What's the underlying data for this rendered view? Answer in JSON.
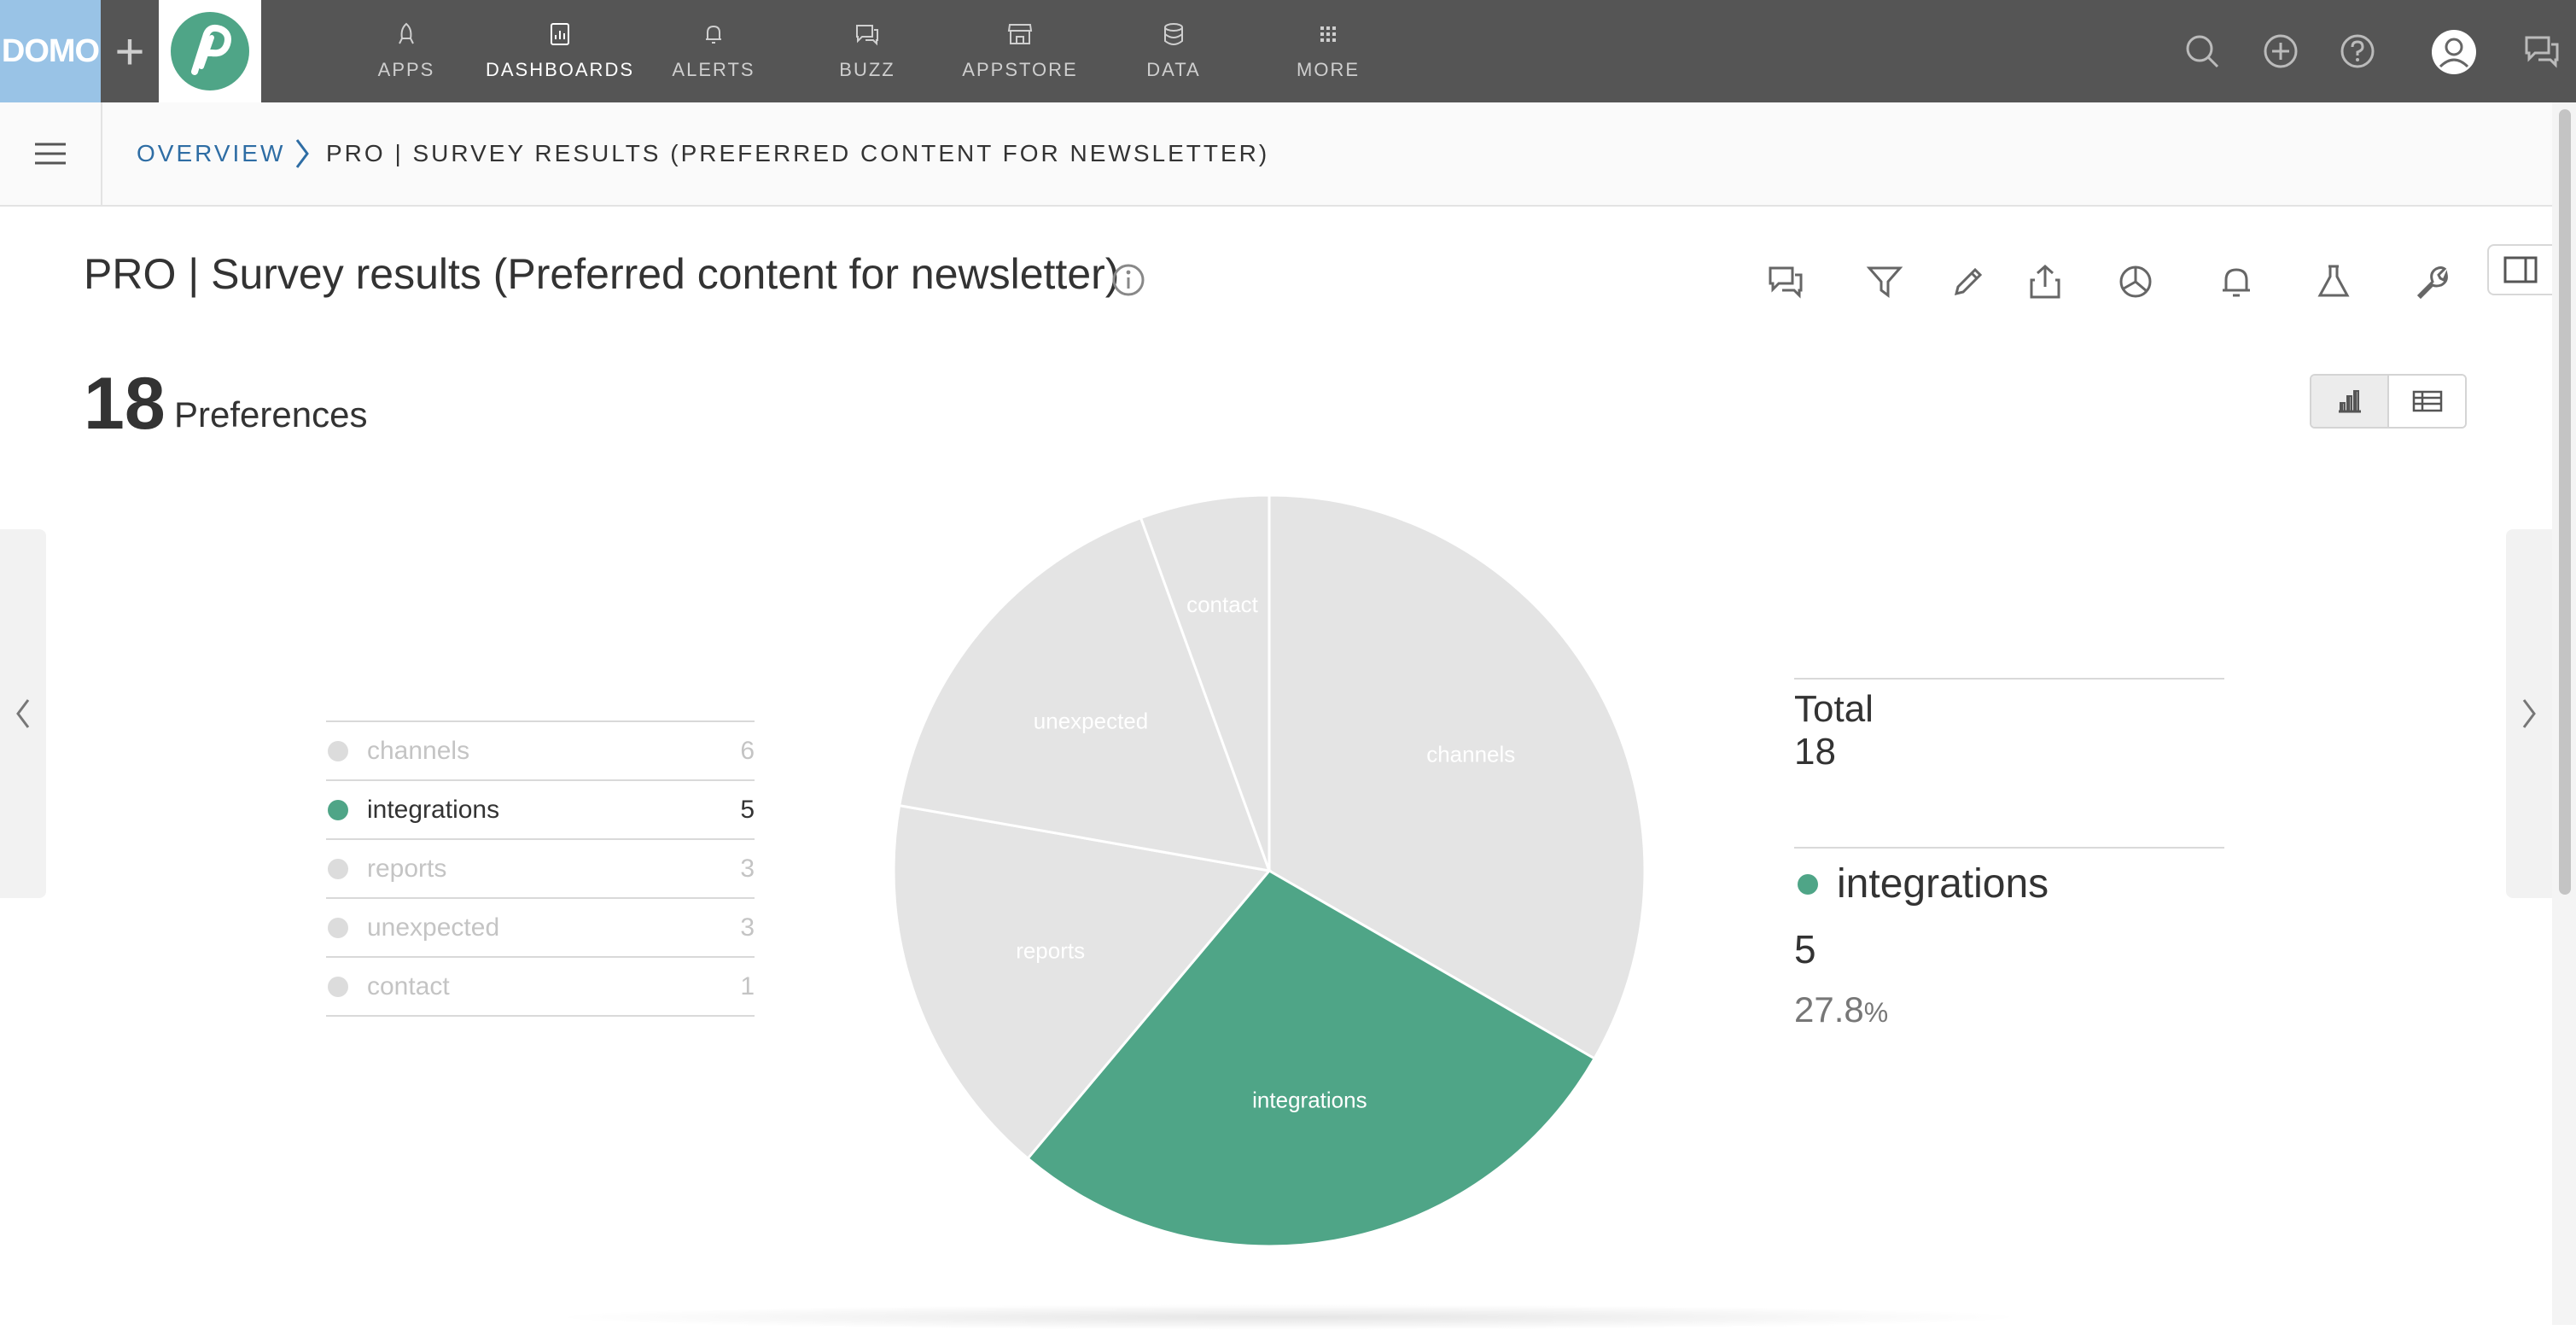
{
  "brand": {
    "domo_label": "DOMO",
    "plus": "+"
  },
  "nav": {
    "items": [
      {
        "label": "APPS",
        "icon": "rocket-icon"
      },
      {
        "label": "DASHBOARDS",
        "icon": "dashboard-icon",
        "active": true
      },
      {
        "label": "ALERTS",
        "icon": "bell-icon"
      },
      {
        "label": "BUZZ",
        "icon": "chat-icon"
      },
      {
        "label": "APPSTORE",
        "icon": "store-icon"
      },
      {
        "label": "DATA",
        "icon": "database-icon"
      },
      {
        "label": "MORE",
        "icon": "grid-icon"
      }
    ]
  },
  "breadcrumb": {
    "parent": "OVERVIEW",
    "current": "PRO | SURVEY RESULTS (PREFERRED CONTENT FOR NEWSLETTER)"
  },
  "card": {
    "title": "PRO | Survey results (Preferred content for newsletter)",
    "summary_number": "18",
    "summary_label": "Preferences"
  },
  "legend": [
    {
      "name": "channels",
      "value": "6"
    },
    {
      "name": "integrations",
      "value": "5",
      "active": true
    },
    {
      "name": "reports",
      "value": "3"
    },
    {
      "name": "unexpected",
      "value": "3"
    },
    {
      "name": "contact",
      "value": "1"
    }
  ],
  "detail": {
    "total_label": "Total",
    "total_value": "18",
    "selected_name": "integrations",
    "selected_value": "5",
    "selected_pct": "27.8",
    "pct_sign": "%"
  },
  "colors": {
    "accent": "#4fa587",
    "inactive_slice": "#e4e4e4",
    "topnav": "#555555"
  },
  "chart_data": {
    "type": "pie",
    "categories": [
      "channels",
      "integrations",
      "reports",
      "unexpected",
      "contact"
    ],
    "values": [
      6,
      5,
      3,
      3,
      1
    ],
    "highlighted": "integrations"
  }
}
